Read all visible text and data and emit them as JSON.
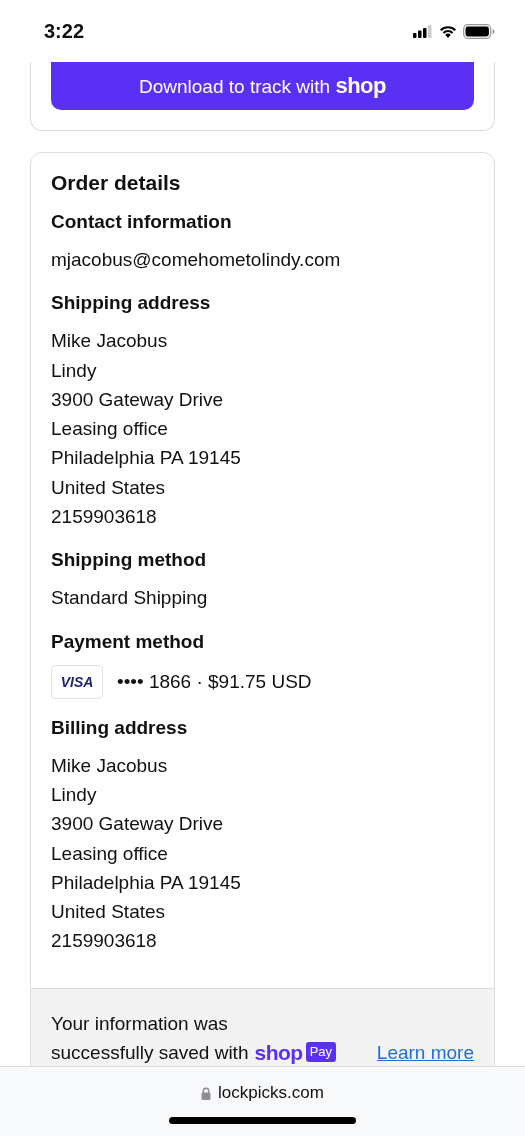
{
  "status_bar": {
    "time": "3:22"
  },
  "shop_button": {
    "label": "Download to track with",
    "brand": "shop"
  },
  "order_details": {
    "title": "Order details",
    "sections": [
      {
        "kind": "lines",
        "heading": "Contact information",
        "lines": [
          "mjacobus@comehometolindy.com"
        ]
      },
      {
        "kind": "lines",
        "heading": "Shipping address",
        "lines": [
          "Mike Jacobus",
          "Lindy",
          "3900 Gateway Drive",
          "Leasing office",
          "Philadelphia PA 19145",
          "United States",
          "2159903618"
        ]
      },
      {
        "kind": "lines",
        "heading": "Shipping method",
        "lines": [
          "Standard Shipping"
        ]
      },
      {
        "kind": "payment",
        "heading": "Payment method",
        "card_brand": "VISA",
        "card_text": "•••• 1866 · $91.75 USD"
      },
      {
        "kind": "lines",
        "heading": "Billing address",
        "lines": [
          "Mike Jacobus",
          "Lindy",
          "3900 Gateway Drive",
          "Leasing office",
          "Philadelphia PA 19145",
          "United States",
          "2159903618"
        ]
      }
    ]
  },
  "saved_notice": {
    "text_lines": [
      "Your information was",
      "successfully saved with"
    ],
    "brand": "shop",
    "badge": "Pay",
    "link": "Learn more"
  },
  "browser_bar": {
    "url": "lockpicks.com"
  }
}
